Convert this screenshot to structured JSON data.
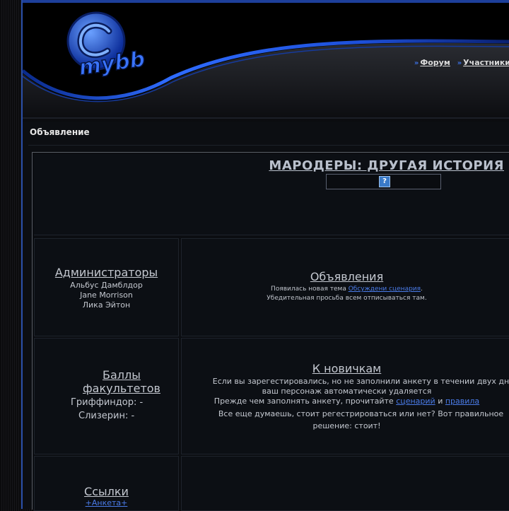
{
  "header": {
    "logo_text": "mybb",
    "nav": [
      {
        "label": "Форум"
      },
      {
        "label": "Участники"
      }
    ],
    "nav_sep": "»"
  },
  "announcement": {
    "heading": "Объявление",
    "title": "МАРОДЕРЫ: ДРУГАЯ ИСТОРИЯ",
    "help_icon": "?"
  },
  "admins": {
    "heading": "Администраторы",
    "names": [
      "Альбус Дамблдор",
      "Jane Morrison",
      "Лика Эйтон"
    ]
  },
  "news": {
    "heading": "Объявления",
    "line1_prefix": "Появилась новая тема ",
    "line1_link": "Обсуждени сценария",
    "line1_suffix": ".",
    "line2": "Убедительная просьба всем отписываться там."
  },
  "points": {
    "heading_line1": "Баллы",
    "heading_line2": "факультетов",
    "houses": [
      {
        "label": "Гриффиндор: -"
      },
      {
        "label": "Слизерин: -"
      }
    ]
  },
  "newbies": {
    "heading": "К новичкам",
    "line1": "Если вы зарегестировались, но не заполнили анкету в течении двух дн",
    "line2": "ваш персонаж автоматически удаляется",
    "line3_prefix": "Прежде чем заполнять анкету, прочитайте ",
    "link_scenario": "сценарий",
    "line3_and": " и ",
    "link_rules": "правила",
    "line4": "Все еще думаешь, стоит регестрироваться или нет? Вот правильное",
    "line5": "решение: стоит!"
  },
  "links": {
    "heading": "Ссылки",
    "item1": "+Анкета+"
  }
}
